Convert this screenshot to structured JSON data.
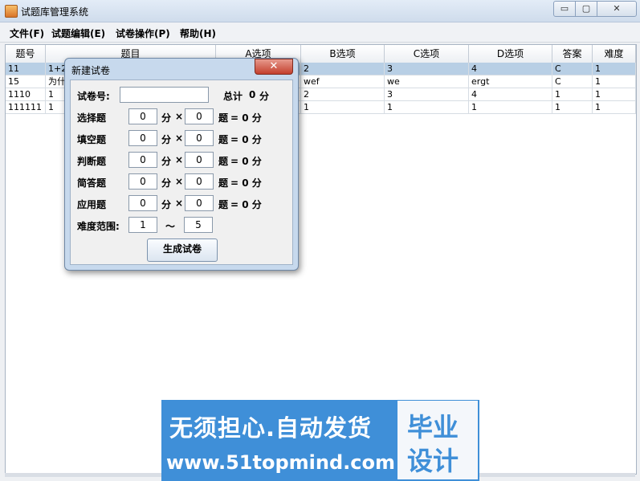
{
  "window": {
    "title": "试题库管理系统",
    "controls": {
      "minimize": "▭",
      "maximize": "▢",
      "close": "✕"
    }
  },
  "menubar": {
    "items": [
      {
        "label": "文件(F)"
      },
      {
        "label": "试题编辑(E)"
      },
      {
        "label": "试卷操作(P)"
      },
      {
        "label": "帮助(H)"
      }
    ]
  },
  "table": {
    "columns": [
      "题号",
      "题目",
      "A选项",
      "B选项",
      "C选项",
      "D选项",
      "答案",
      "难度"
    ],
    "rows": [
      [
        "11",
        "1+2",
        "",
        "2",
        "3",
        "4",
        "C",
        "1"
      ],
      [
        "15",
        "为什",
        "",
        "wef",
        "we",
        "ergt",
        "C",
        "1"
      ],
      [
        "1110",
        "1",
        "",
        "2",
        "3",
        "4",
        "1",
        "1"
      ],
      [
        "111111",
        "1",
        "",
        "1",
        "1",
        "1",
        "1",
        "1"
      ]
    ],
    "selected_row": 0
  },
  "dialog": {
    "title": "新建试卷",
    "close_glyph": "✕",
    "paper_no_label": "试卷号:",
    "paper_no_value": "",
    "total_label": "总计",
    "total_value": "0",
    "total_unit": "分",
    "rows": [
      {
        "label": "选择题",
        "points": "0",
        "count": "0"
      },
      {
        "label": "填空题",
        "points": "0",
        "count": "0"
      },
      {
        "label": "判断题",
        "points": "0",
        "count": "0"
      },
      {
        "label": "简答题",
        "points": "0",
        "count": "0"
      },
      {
        "label": "应用题",
        "points": "0",
        "count": "0"
      }
    ],
    "points_unit": "分",
    "times": "×",
    "count_unit": "题",
    "equals_text": "= 0 分",
    "difficulty_label": "难度范围:",
    "difficulty_min": "1",
    "tilde": "～",
    "difficulty_max": "5",
    "generate_button": "生成试卷"
  },
  "watermark": {
    "line1": "无须担心.自动发货",
    "line2": "www.51topmind.com",
    "right1": "毕业",
    "right2": "设计"
  }
}
